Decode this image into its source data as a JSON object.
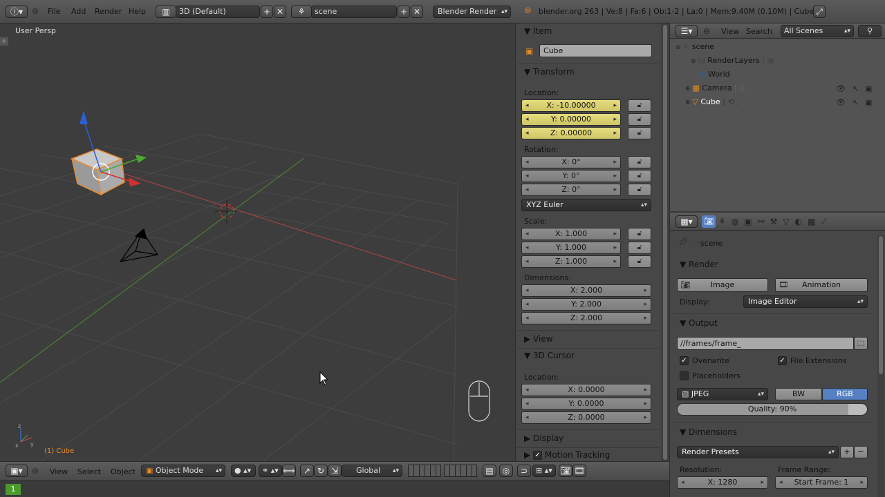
{
  "topbar": {
    "menus": [
      "File",
      "Add",
      "Render",
      "Help"
    ],
    "screen_layout": "3D (Default)",
    "scene": "scene",
    "render_engine": "Blender Render",
    "stats": "blender.org 263 | Ve:8 | Fa:6 | Ob:1-2 | La:0 | Mem:9.40M (0.10M) | Cube"
  },
  "viewport": {
    "view_label": "User Persp",
    "object_label": "(1) Cube"
  },
  "npanel": {
    "item_header": "Item",
    "object_name": "Cube",
    "transform_header": "Transform",
    "location_label": "Location:",
    "location": [
      "X: -10.00000",
      "Y: 0.00000",
      "Z: 0.00000"
    ],
    "rotation_label": "Rotation:",
    "rotation": [
      "X: 0°",
      "Y: 0°",
      "Z: 0°"
    ],
    "rotation_mode": "XYZ Euler",
    "scale_label": "Scale:",
    "scale": [
      "X: 1.000",
      "Y: 1.000",
      "Z: 1.000"
    ],
    "dimensions_label": "Dimensions:",
    "dimensions": [
      "X: 2.000",
      "Y: 2.000",
      "Z: 2.000"
    ],
    "view_header": "View",
    "cursor_header": "3D Cursor",
    "cursor_location_label": "Location:",
    "cursor_location": [
      "X: 0.0000",
      "Y: 0.0000",
      "Z: 0.0000"
    ],
    "display_header": "Display",
    "motion_tracking_header": "Motion Tracking"
  },
  "outliner": {
    "view_menu": "View",
    "search_menu": "Search",
    "filter": "All Scenes",
    "items": [
      "scene",
      "RenderLayers",
      "World",
      "Camera",
      "Cube"
    ]
  },
  "properties": {
    "context": "scene",
    "render_header": "Render",
    "image_button": "Image",
    "animation_button": "Animation",
    "display_label": "Display:",
    "display_value": "Image Editor",
    "output_header": "Output",
    "output_path": "//frames/frame_",
    "overwrite": "Overwrite",
    "file_extensions": "File Extensions",
    "placeholders": "Placeholders",
    "format": "JPEG",
    "bw": "BW",
    "rgb": "RGB",
    "quality": "Quality: 90%",
    "quality_value": 0.9,
    "dimensions_header": "Dimensions",
    "render_presets": "Render Presets",
    "resolution_label": "Resolution:",
    "resolution_x": "X: 1280",
    "frame_range_label": "Frame Range:",
    "start_frame": "Start Frame: 1"
  },
  "bottombar": {
    "view": "View",
    "select": "Select",
    "object": "Object",
    "mode": "Object Mode",
    "orientation": "Global"
  },
  "timeline": {
    "frame": "1"
  },
  "colors": {
    "selected_orange": "#e8892a",
    "x_axis": "#c84040",
    "y_axis": "#5fa03a",
    "highlight_yellow": "#e0d676",
    "rgb_blue": "#5680c2"
  }
}
